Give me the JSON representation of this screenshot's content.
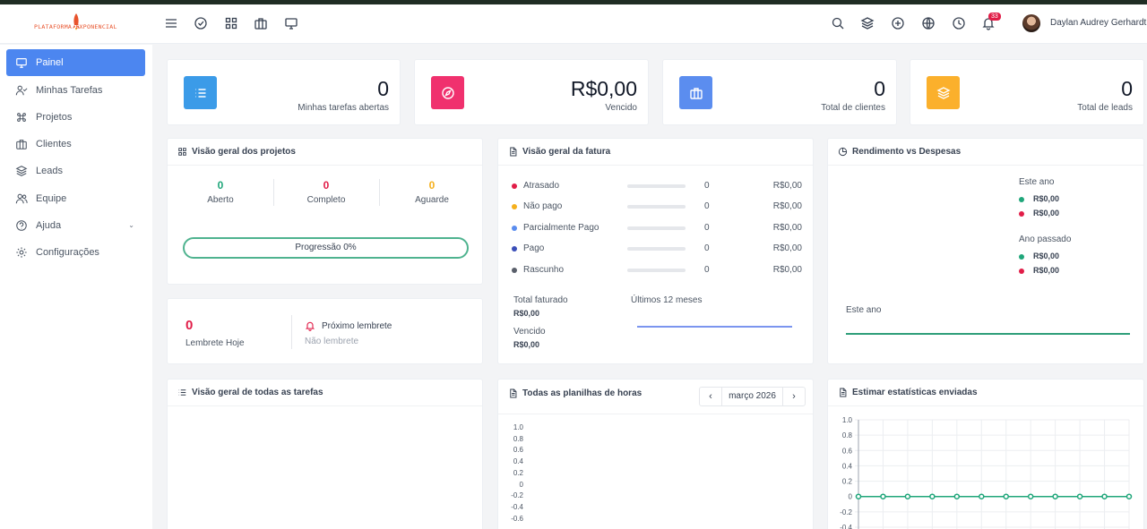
{
  "brand": {
    "logo_text": "PLATAFORMA EXPONENCIAL"
  },
  "header": {
    "notifications_count": "33",
    "user_name": "Daylan Audrey Gerhardt"
  },
  "sidebar": {
    "items": [
      {
        "label": "Painel"
      },
      {
        "label": "Minhas Tarefas"
      },
      {
        "label": "Projetos"
      },
      {
        "label": "Clientes"
      },
      {
        "label": "Leads"
      },
      {
        "label": "Equipe"
      },
      {
        "label": "Ajuda"
      },
      {
        "label": "Configurações"
      }
    ]
  },
  "stats": [
    {
      "value": "0",
      "label": "Minhas tarefas abertas",
      "color": "#3b9be8"
    },
    {
      "value": "R$0,00",
      "label": "Vencido",
      "color": "#f0316e"
    },
    {
      "value": "0",
      "label": "Total de clientes",
      "color": "#5b8def"
    },
    {
      "value": "0",
      "label": "Total de leads",
      "color": "#fbb02c"
    }
  ],
  "projects": {
    "title": "Visão geral dos projetos",
    "open": {
      "value": "0",
      "label": "Aberto",
      "color": "#1fa67a"
    },
    "complete": {
      "value": "0",
      "label": "Completo",
      "color": "#e11d48"
    },
    "waiting": {
      "value": "0",
      "label": "Aguarde",
      "color": "#f5b01c"
    },
    "progress_label": "Progressão 0%"
  },
  "reminders": {
    "today_value": "0",
    "today_label": "Lembrete Hoje",
    "next_title": "Próximo lembrete",
    "next_value": "Não lembrete"
  },
  "invoices": {
    "title": "Visão geral da fatura",
    "rows": [
      {
        "label": "Atrasado",
        "count": "0",
        "amount": "R$0,00",
        "color": "#e11d48"
      },
      {
        "label": "Não pago",
        "count": "0",
        "amount": "R$0,00",
        "color": "#f5b01c"
      },
      {
        "label": "Parcialmente Pago",
        "count": "0",
        "amount": "R$0,00",
        "color": "#5b8def"
      },
      {
        "label": "Pago",
        "count": "0",
        "amount": "R$0,00",
        "color": "#3b4fb8"
      },
      {
        "label": "Rascunho",
        "count": "0",
        "amount": "R$0,00",
        "color": "#5a5f6b"
      }
    ],
    "total_label": "Total faturado",
    "total_value": "R$0,00",
    "due_label": "Vencido",
    "due_value": "R$0,00",
    "period_label": "Últimos 12 meses"
  },
  "income": {
    "title": "Rendimento vs Despesas",
    "this_year": "Este ano",
    "last_year": "Ano passado",
    "values": {
      "this_income": "R$0,00",
      "this_expense": "R$0,00",
      "last_income": "R$0,00",
      "last_expense": "R$0,00"
    },
    "chart_label": "Este ano"
  },
  "tasks_overview": {
    "title": "Visão geral de todas as tarefas"
  },
  "timesheets": {
    "title": "Todas as planilhas de horas",
    "month": "março 2026",
    "y_ticks": [
      "1.0",
      "0.8",
      "0.6",
      "0.4",
      "0.2",
      "0",
      "-0.2",
      "-0.4",
      "-0.6"
    ]
  },
  "estimates": {
    "title": "Estimar estatísticas enviadas",
    "y_ticks": [
      "1.0",
      "0.8",
      "0.6",
      "0.4",
      "0.2",
      "0",
      "-0.2",
      "-0.4"
    ]
  },
  "chart_data": {
    "type": "line",
    "y_ticks": [
      "1.0",
      "0.8",
      "0.6",
      "0.4",
      "0.2",
      "0",
      "-0.2",
      "-0.4"
    ],
    "ylim": [
      -0.4,
      1.0
    ],
    "series": [
      {
        "values": [
          0,
          0,
          0,
          0,
          0,
          0,
          0,
          0,
          0,
          0,
          0,
          0
        ],
        "color": "#1fa67a"
      }
    ],
    "grid": true
  }
}
